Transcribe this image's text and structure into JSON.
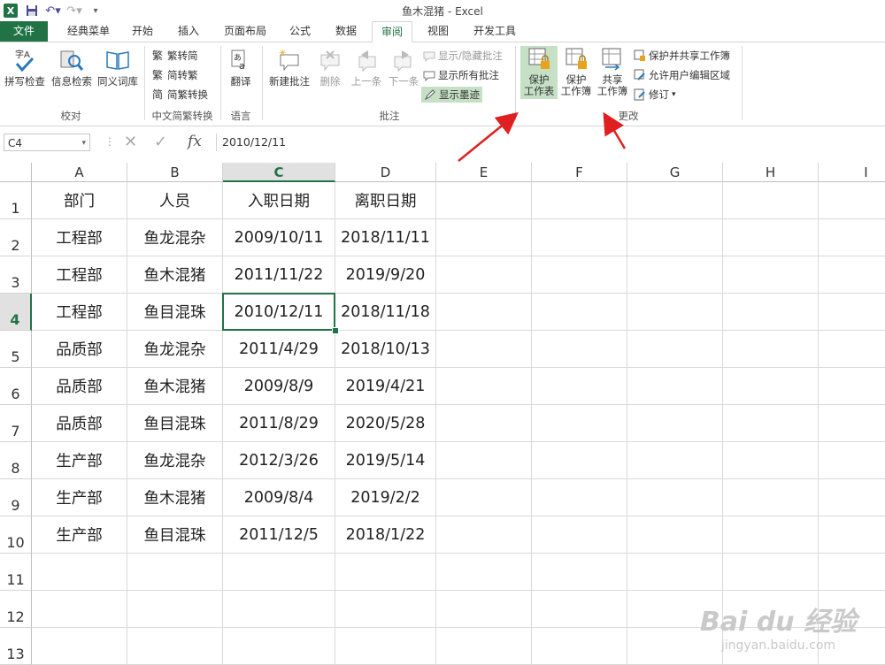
{
  "app": {
    "window_title": "鱼木混猪 - Excel",
    "accent": "#217346"
  },
  "tabs": [
    "文件",
    "经典菜单",
    "开始",
    "插入",
    "页面布局",
    "公式",
    "数据",
    "审阅",
    "视图",
    "开发工具"
  ],
  "active_tab": "审阅",
  "ribbon": {
    "proofing": {
      "spell": "拼写检查",
      "research": "信息检索",
      "thesaurus": "同义词库",
      "group": "校对"
    },
    "chinese": {
      "t2s": "繁转简",
      "s2t": "简转繁",
      "convert": "简繁转换",
      "group": "中文简繁转换"
    },
    "language": {
      "translate": "翻译",
      "group": "语言"
    },
    "comments": {
      "new": "新建批注",
      "delete": "删除",
      "prev": "上一条",
      "next": "下一条",
      "show_hide": "显示/隐藏批注",
      "show_all": "显示所有批注",
      "show_ink": "显示墨迹",
      "group": "批注"
    },
    "changes": {
      "protect_sheet_1": "保护",
      "protect_sheet_2": "工作表",
      "protect_wb_1": "保护",
      "protect_wb_2": "工作簿",
      "share_1": "共享",
      "share_2": "工作簿",
      "protect_share": "保护并共享工作簿",
      "allow_edit": "允许用户编辑区域",
      "track": "修订",
      "group": "更改"
    }
  },
  "formula_bar": {
    "name_box": "C4",
    "formula": "2010/12/11"
  },
  "sheet": {
    "columns": [
      "A",
      "B",
      "C",
      "D",
      "E",
      "F",
      "G",
      "H",
      "I"
    ],
    "active_col": "C",
    "active_row": 4,
    "rows": [
      [
        "部门",
        "人员",
        "入职日期",
        "离职日期"
      ],
      [
        "工程部",
        "鱼龙混杂",
        "2009/10/11",
        "2018/11/11"
      ],
      [
        "工程部",
        "鱼木混猪",
        "2011/11/22",
        "2019/9/20"
      ],
      [
        "工程部",
        "鱼目混珠",
        "2010/12/11",
        "2018/11/18"
      ],
      [
        "品质部",
        "鱼龙混杂",
        "2011/4/29",
        "2018/10/13"
      ],
      [
        "品质部",
        "鱼木混猪",
        "2009/8/9",
        "2019/4/21"
      ],
      [
        "品质部",
        "鱼目混珠",
        "2011/8/29",
        "2020/5/28"
      ],
      [
        "生产部",
        "鱼龙混杂",
        "2012/3/26",
        "2019/5/14"
      ],
      [
        "生产部",
        "鱼木混猪",
        "2009/8/4",
        "2019/2/2"
      ],
      [
        "生产部",
        "鱼目混珠",
        "2011/12/5",
        "2018/1/22"
      ],
      [
        "",
        "",
        "",
        ""
      ],
      [
        "",
        "",
        "",
        ""
      ],
      [
        "",
        "",
        "",
        ""
      ]
    ],
    "row_numbers": [
      "1",
      "2",
      "3",
      "4",
      "5",
      "6",
      "7",
      "8",
      "9",
      "10",
      "11",
      "12",
      "13"
    ]
  },
  "watermark": {
    "logo": "Bai du 经验",
    "url": "jingyan.baidu.com"
  }
}
